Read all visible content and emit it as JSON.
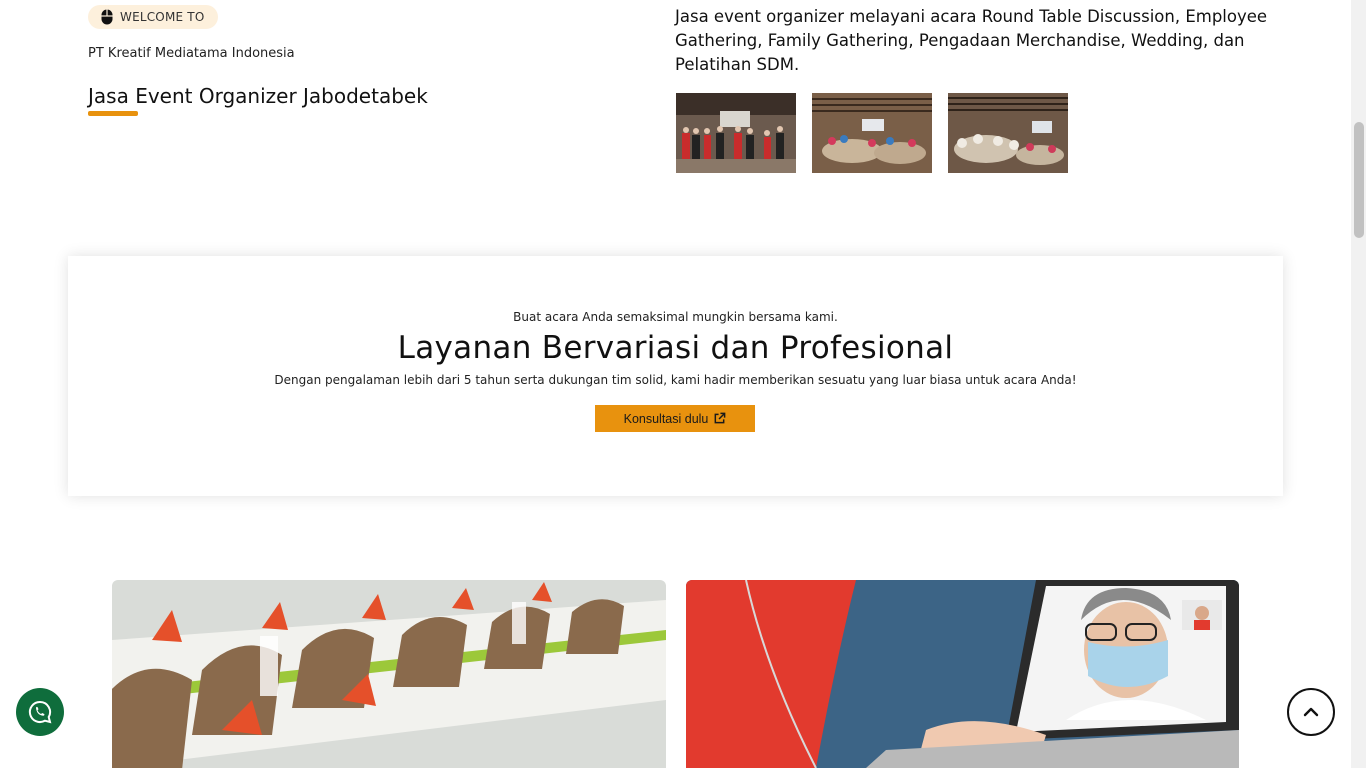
{
  "hero": {
    "badge_label": "WELCOME TO",
    "badge_icon": "mouse-icon",
    "company": "PT Kreatif Mediatama Indonesia",
    "title": "Jasa Event Organizer Jabodetabek",
    "description": "Jasa event organizer melayani acara Round Table Discussion, Employee Gathering, Family Gathering, Pengadaan Merchandise, Wedding, dan Pelatihan SDM.",
    "gallery": [
      "event-photo-group",
      "event-photo-room",
      "event-photo-seminar"
    ]
  },
  "services": {
    "kicker": "Buat acara Anda semaksimal mungkin bersama kami.",
    "title": "Layanan Bervariasi dan Profesional",
    "subtitle": "Dengan pengalaman lebih dari 5 tahun serta dukungan tim solid, kami hadir memberikan sesuatu yang luar biasa untuk acara Anda!",
    "cta_label": "Konsultasi dulu",
    "cta_icon": "external-link-icon"
  },
  "cards": [
    "banquet-table-photo",
    "video-call-photo"
  ],
  "floating": {
    "whatsapp_icon": "whatsapp-icon",
    "back_to_top_icon": "chevron-up-icon"
  },
  "colors": {
    "accent": "#e8920e",
    "badge_bg": "#fdf0dc",
    "whatsapp": "#0f6d3c"
  }
}
